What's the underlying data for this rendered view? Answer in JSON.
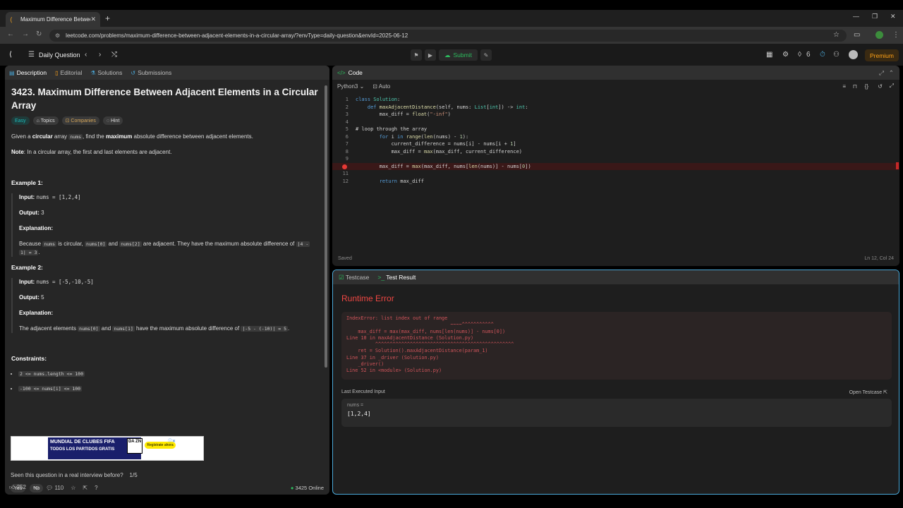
{
  "browser": {
    "tab_title": "Maximum Difference Between",
    "url": "leetcode.com/problems/maximum-difference-between-adjacent-elements-in-a-circular-array/?envType=daily-question&envId=2025-06-12"
  },
  "header": {
    "title": "Daily Question",
    "submit_label": "Submit",
    "streak_count": "6",
    "premium_label": "Premium"
  },
  "left": {
    "tabs": [
      "Description",
      "Editorial",
      "Solutions",
      "Submissions"
    ],
    "problem_title": "3423. Maximum Difference Between Adjacent Elements in a Circular Array",
    "pills": [
      "Easy",
      "Topics",
      "Companies",
      "Hint"
    ],
    "desc": {
      "p1a": "Given a ",
      "p1b": "circular",
      "p1c": " array ",
      "p1code": "nums",
      "p1d": ", find the ",
      "p1e": "maximum",
      "p1f": " absolute difference between adjacent elements.",
      "note_label": "Note",
      "note_text": ": In a circular array, the first and last elements are adjacent."
    },
    "ex1": {
      "heading": "Example 1:",
      "input_label": "Input:",
      "input_value": "nums = [1,2,4]",
      "output_label": "Output:",
      "output_value": "3",
      "expl_label": "Explanation:",
      "expl_a": "Because ",
      "expl_code1": "nums",
      "expl_b": " is circular, ",
      "expl_code2": "nums[0]",
      "expl_c": " and ",
      "expl_code3": "nums[2]",
      "expl_d": " are adjacent. They have the maximum absolute difference of ",
      "expl_code4a": "|4 -",
      "expl_code4b": "1| = 3",
      "expl_e": "."
    },
    "ex2": {
      "heading": "Example 2:",
      "input_label": "Input:",
      "input_value": "nums = [-5,-10,-5]",
      "output_label": "Output:",
      "output_value": "5",
      "expl_label": "Explanation:",
      "expl_a": "The adjacent elements ",
      "expl_code1": "nums[0]",
      "expl_b": " and ",
      "expl_code2": "nums[1]",
      "expl_c": " have the maximum absolute difference of ",
      "expl_code3": "|-5 - (-10)| = 5",
      "expl_d": "."
    },
    "constraints_heading": "Constraints:",
    "constraints": [
      "2 <= nums.length <= 100",
      "-100 <= nums[i] <= 100"
    ],
    "ad": {
      "line1": "MUNDIAL DE CLUBES FIFA",
      "line2": "TODOS LOS PARTIDOS GRATIS",
      "logo": "DA ZN",
      "cta": "Regístrate ahora"
    },
    "interview_q": "Seen this question in a real interview before?",
    "interview_count": "1/5",
    "yes_label": "Yes",
    "no_label": "No",
    "likes": "252",
    "comments": "110",
    "online": "3425 Online"
  },
  "code": {
    "panel_title": "Code",
    "language": "Python3",
    "mode": "Auto",
    "saved": "Saved",
    "cursor": "Ln 12, Col 24",
    "lines": [
      {
        "n": "1",
        "text": "class Solution:"
      },
      {
        "n": "2",
        "text": "    def maxAdjacentDistance(self, nums: List[int]) -> int:"
      },
      {
        "n": "3",
        "text": "        max_diff = float(\"-inf\")"
      },
      {
        "n": "4",
        "text": ""
      },
      {
        "n": "5",
        "text": "        # loop through the array"
      },
      {
        "n": "6",
        "text": "        for i in range(len(nums) - 1):"
      },
      {
        "n": "7",
        "text": "            current_difference = nums[i] - nums[i + 1]"
      },
      {
        "n": "8",
        "text": "            max_diff = max(max_diff, current_difference)"
      },
      {
        "n": "9",
        "text": ""
      },
      {
        "n": "",
        "text": "        max_diff = max(max_diff, nums[len(nums)] - nums[0])"
      },
      {
        "n": "11",
        "text": ""
      },
      {
        "n": "12",
        "text": "        return max_diff"
      }
    ]
  },
  "result": {
    "tabs": [
      "Testcase",
      "Test Result"
    ],
    "status": "Runtime Error",
    "trace": "IndexError: list index out of range\n                                    ~~~~^^^^^^^^^^^\n    max_diff = max(max_diff, nums[len(nums)] - nums[0])\nLine 10 in maxAdjacentDistance (Solution.py)\n          ^^^^^^^^^^^^^^^^^^^^^^^^^^^^^^^^^^^^^^^^^^^^^^^^\n    ret = Solution().maxAdjacentDistance(param_1)\nLine 37 in _driver (Solution.py)\n    _driver()\nLine 52 in <module> (Solution.py)",
    "last_input_label": "Last Executed Input",
    "open_testcase": "Open Testcase",
    "input_name": "nums =",
    "input_value": "[1,2,4]"
  }
}
